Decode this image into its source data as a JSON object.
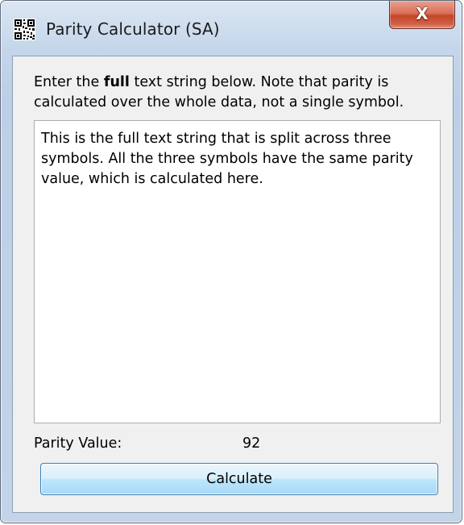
{
  "window": {
    "title": "Parity Calculator (SA)",
    "close_glyph": "X"
  },
  "form": {
    "instruction_prefix": "Enter the ",
    "instruction_bold": "full",
    "instruction_suffix": " text string below. Note that parity is calculated over the whole data, not a single symbol.",
    "text_value": "This is the full text string that is split across three symbols. All the three symbols have the same parity value, which is calculated here.",
    "parity_label": "Parity Value:",
    "parity_value": "92",
    "calculate_label": "Calculate"
  },
  "icons": {
    "app_icon": "qr-code-icon",
    "close_icon": "close-icon"
  },
  "colors": {
    "close_button": "#c54528",
    "button_accent": "#3c7fb1",
    "window_frame": "#bccfe6"
  }
}
